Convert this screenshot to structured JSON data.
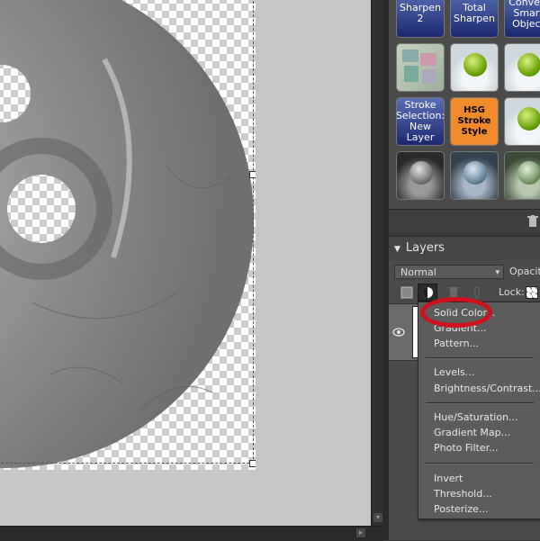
{
  "effects": {
    "thumbnails": [
      {
        "label": "Sharpen 2"
      },
      {
        "label": "Total Sharpen"
      },
      {
        "label": "Convert Smart Object"
      },
      {
        "label": ""
      },
      {
        "label": ""
      },
      {
        "label": ""
      },
      {
        "label": "Stroke Selection: New Layer"
      },
      {
        "label": "HSG Stroke Style"
      },
      {
        "label": ""
      },
      {
        "label": ""
      },
      {
        "label": ""
      },
      {
        "label": ""
      }
    ]
  },
  "layers": {
    "title": "Layers",
    "blend_mode": "Normal",
    "opacity_label": "Opacity:",
    "lock_label": "Lock:"
  },
  "adjustment_menu": {
    "items": [
      {
        "label": "Solid Color..."
      },
      {
        "label": "Gradient..."
      },
      {
        "label": "Pattern..."
      },
      {
        "label": "Levels..."
      },
      {
        "label": "Brightness/Contrast..."
      },
      {
        "label": "Hue/Saturation..."
      },
      {
        "label": "Gradient Map..."
      },
      {
        "label": "Photo Filter..."
      },
      {
        "label": "Invert"
      },
      {
        "label": "Threshold..."
      },
      {
        "label": "Posterize..."
      }
    ]
  },
  "colors": {
    "highlight_ring": "#d0101a",
    "panel_bg": "#4a4a4a",
    "canvas_bg": "#c6c6c6"
  }
}
